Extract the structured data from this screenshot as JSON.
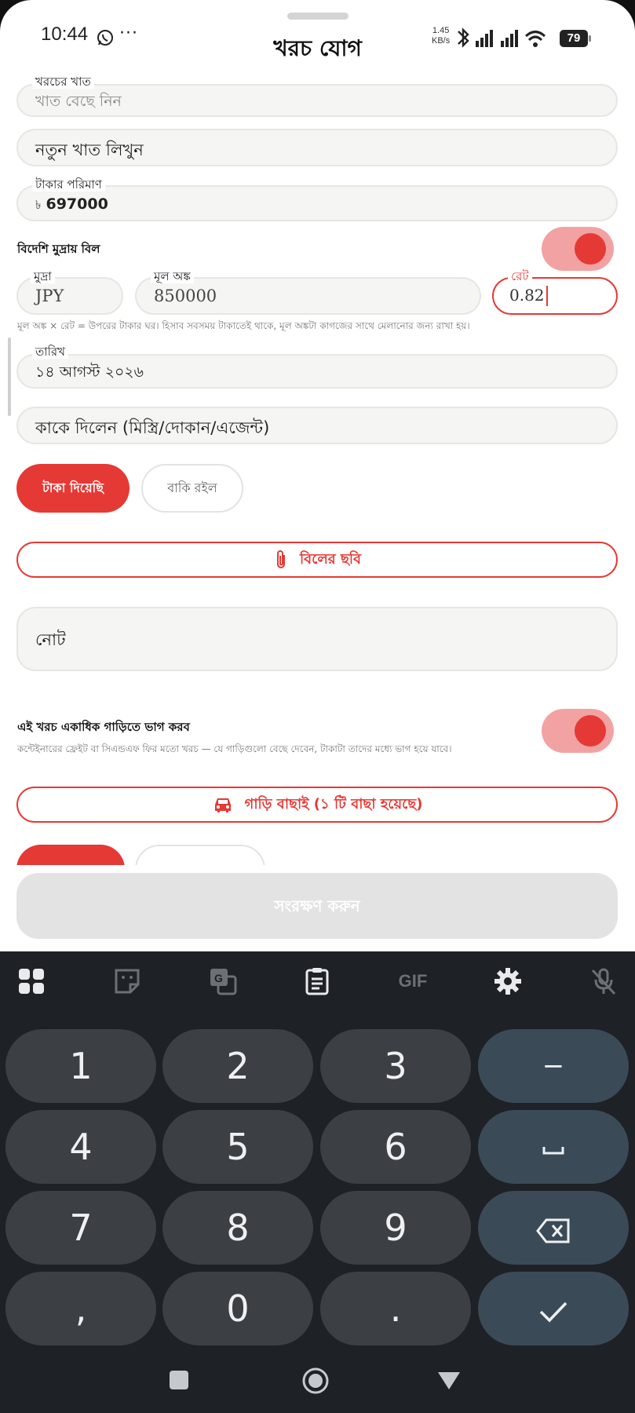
{
  "status_bar": {
    "time": "10:44",
    "more": "···",
    "net_speed_value": "1.45",
    "net_speed_unit": "KB/s",
    "battery": "79"
  },
  "header": {
    "title": "খরচ যোগ"
  },
  "form": {
    "category": {
      "label": "খরচের খাত",
      "placeholder": "খাত বেছে নিন"
    },
    "new_category": {
      "placeholder": "নতুন খাত লিখুন"
    },
    "amount": {
      "label": "টাকার পরিমাণ",
      "currency_symbol": "৳",
      "value": "697000"
    },
    "foreign_bill": {
      "label": "বিদেশি মুদ্রায় বিল",
      "enabled": true
    },
    "currency": {
      "label": "মুদ্রা",
      "value": "JPY"
    },
    "original_amount": {
      "label": "মূল অঙ্ক",
      "value": "850000"
    },
    "rate": {
      "label": "রেট",
      "value": "0.82"
    },
    "foreign_hint": "মূল অঙ্ক × রেট = উপরের টাকার ঘর। হিসাব সবসময় টাকাতেই থাকে, মূল অঙ্কটা কাগজের সাথে মেলানোর জন্য রাখা হয়।",
    "date": {
      "label": "তারিখ",
      "value": "১৪ আগস্ট ২০২৬"
    },
    "payee": {
      "placeholder": "কাকে দিলেন (মিস্ত্রি/দোকান/এজেন্ট)"
    },
    "payment_status": {
      "paid": "টাকা দিয়েছি",
      "due": "বাকি রইল",
      "selected": "paid"
    },
    "bill_photo_button": "বিলের ছবি",
    "note": {
      "placeholder": "নোট"
    },
    "split": {
      "label": "এই খরচ একাধিক গাড়িতে ভাগ করব",
      "hint": "কন্টেইনারের ফ্রেইট বা সিএন্ডএফ ফির মতো খরচ — যে গাড়িগুলো বেছে দেবেন, টাকাটা তাদের মধ্যে ভাগ হয়ে যাবে।",
      "enabled": true
    },
    "car_select_button": "গাড়ি বাছাই (১ টি বাছা হয়েছে)"
  },
  "save_button": "সংরক্ষণ করুন",
  "keyboard": {
    "toolbar_gif": "GIF",
    "rows": [
      [
        "1",
        "2",
        "3",
        "−"
      ],
      [
        "4",
        "5",
        "6",
        "␣"
      ],
      [
        "7",
        "8",
        "9",
        "⌫"
      ],
      [
        ",",
        "0",
        ".",
        "✓"
      ]
    ]
  },
  "colors": {
    "accent": "#e53935",
    "toggle_track": "#f2a2a2",
    "field_bg": "#f5f5f3",
    "keyboard_bg": "#1e2126"
  }
}
